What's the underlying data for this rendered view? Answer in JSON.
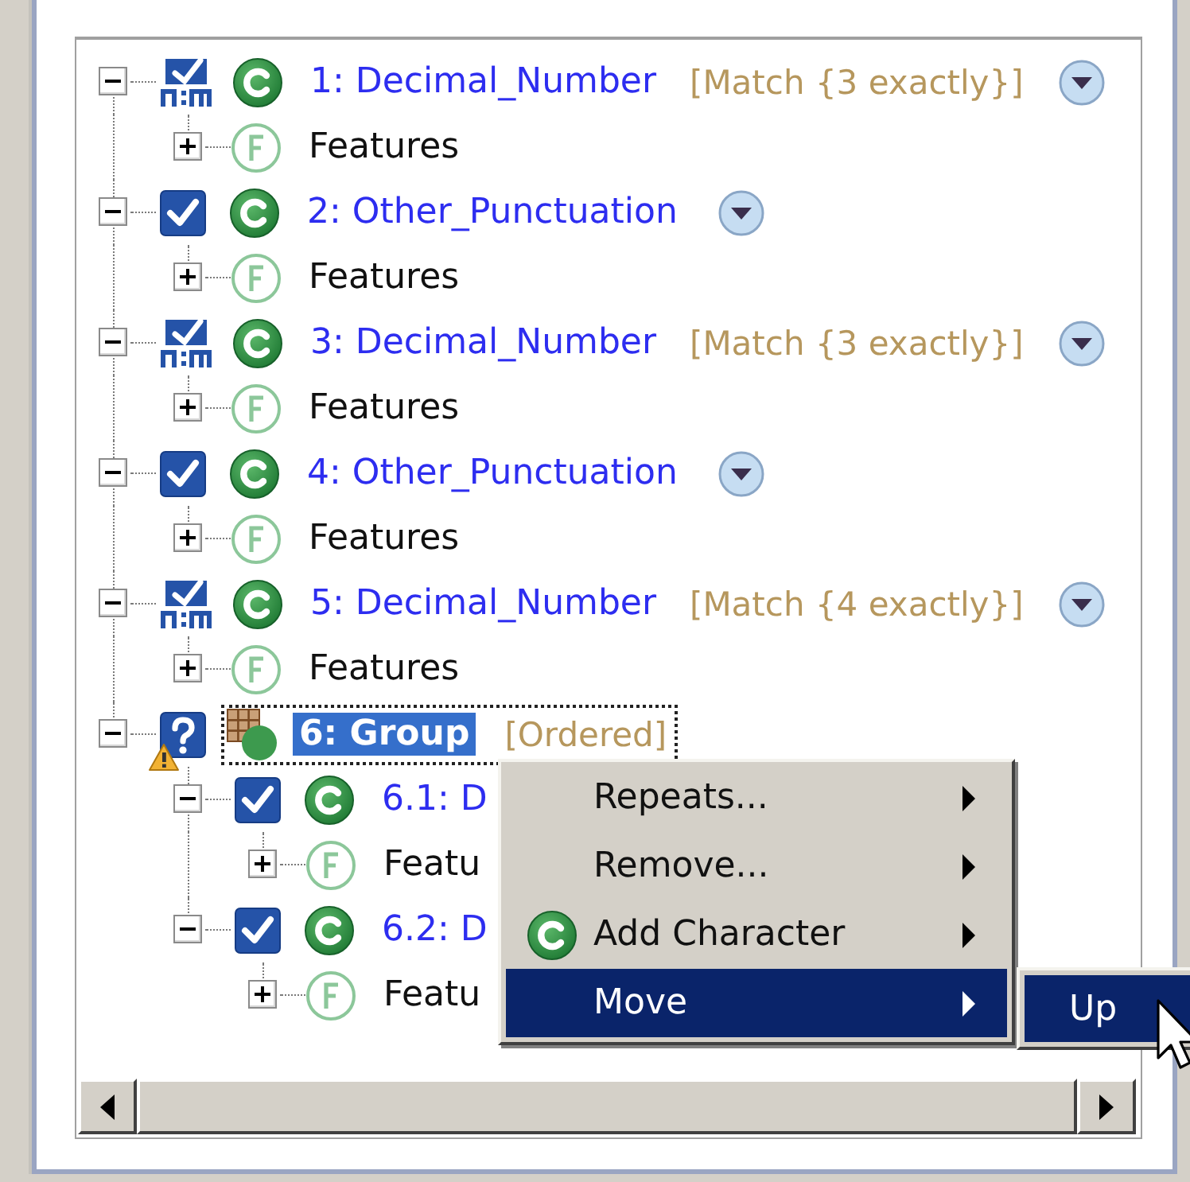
{
  "tree": {
    "items": [
      {
        "kind": "repeat",
        "expanded": true,
        "checked": true,
        "label": "1: Decimal_Number",
        "quantifier": "[Match {3 exactly}]",
        "menu_button": true,
        "selected": false,
        "children": [
          {
            "kind": "features",
            "expanded": false,
            "label": "Features",
            "selected": false
          }
        ]
      },
      {
        "kind": "single",
        "expanded": true,
        "checked": true,
        "label": "2: Other_Punctuation",
        "menu_button": true,
        "selected": false,
        "children": [
          {
            "kind": "features",
            "expanded": false,
            "label": "Features",
            "selected": false
          }
        ]
      },
      {
        "kind": "repeat",
        "expanded": true,
        "checked": true,
        "label": "3: Decimal_Number",
        "quantifier": "[Match {3 exactly}]",
        "menu_button": true,
        "selected": false,
        "children": [
          {
            "kind": "features",
            "expanded": false,
            "label": "Features",
            "selected": false
          }
        ]
      },
      {
        "kind": "single",
        "expanded": true,
        "checked": true,
        "label": "4: Other_Punctuation",
        "menu_button": true,
        "selected": false,
        "children": [
          {
            "kind": "features",
            "expanded": false,
            "label": "Features",
            "selected": false
          }
        ]
      },
      {
        "kind": "repeat",
        "expanded": true,
        "checked": true,
        "label": "5: Decimal_Number",
        "quantifier": "[Match {4 exactly}]",
        "menu_button": true,
        "selected": false,
        "children": [
          {
            "kind": "features",
            "expanded": false,
            "label": "Features",
            "selected": false
          }
        ]
      },
      {
        "kind": "group",
        "expanded": true,
        "warning": true,
        "label": "6: Group",
        "quantifier": "[Ordered]",
        "selected": true,
        "children": [
          {
            "kind": "single",
            "expanded": true,
            "checked": true,
            "label": "6.1: D",
            "selected": false,
            "children": [
              {
                "kind": "features",
                "expanded": false,
                "label": "Featu",
                "selected": false
              }
            ]
          },
          {
            "kind": "single",
            "expanded": true,
            "checked": true,
            "label": "6.2: D",
            "selected": false,
            "children": [
              {
                "kind": "features",
                "expanded": false,
                "label": "Featu",
                "selected": false
              }
            ]
          }
        ]
      }
    ]
  },
  "context_menu": {
    "items": [
      {
        "kind": "plain",
        "label": "Repeats...",
        "submenu": true,
        "selected": false
      },
      {
        "kind": "plain",
        "label": "Remove...",
        "submenu": true,
        "selected": false
      },
      {
        "kind": "character",
        "label": "Add Character",
        "submenu": true,
        "selected": false
      },
      {
        "kind": "plain",
        "label": "Move",
        "submenu": true,
        "selected": true
      }
    ],
    "submenu": {
      "items": [
        {
          "label": "Up",
          "selected": true
        }
      ]
    }
  }
}
